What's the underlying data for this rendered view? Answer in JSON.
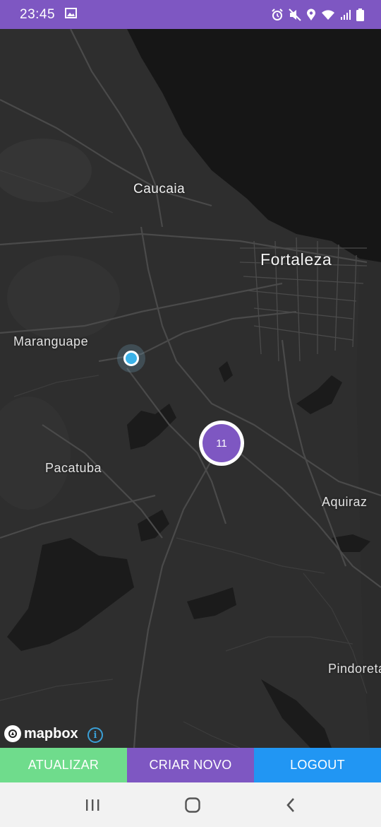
{
  "status_bar": {
    "time": "23:45",
    "icons": [
      "image-icon",
      "alarm-icon",
      "mute-icon",
      "location-icon",
      "wifi-icon",
      "signal-icon",
      "battery-icon"
    ]
  },
  "map": {
    "places": {
      "caucaia": "Caucaia",
      "fortaleza": "Fortaleza",
      "maranguape": "Maranguape",
      "pacatuba": "Pacatuba",
      "aquiraz": "Aquiraz",
      "pindoretama": "Pindoreta"
    },
    "cluster_count": "11",
    "attribution": "mapbox",
    "colors": {
      "land": "#2e2e2e",
      "sea": "#161616",
      "roads": "#4a4a4a",
      "water": "#1b1b1b"
    }
  },
  "buttons": {
    "refresh": "ATUALIZAR",
    "create": "CRIAR NOVO",
    "logout": "LOGOUT",
    "colors": {
      "refresh": "#6fdc8c",
      "create": "#7e57c2",
      "logout": "#2196f3"
    }
  },
  "nav": {
    "icons": [
      "recent-apps-icon",
      "home-icon",
      "back-icon"
    ]
  }
}
